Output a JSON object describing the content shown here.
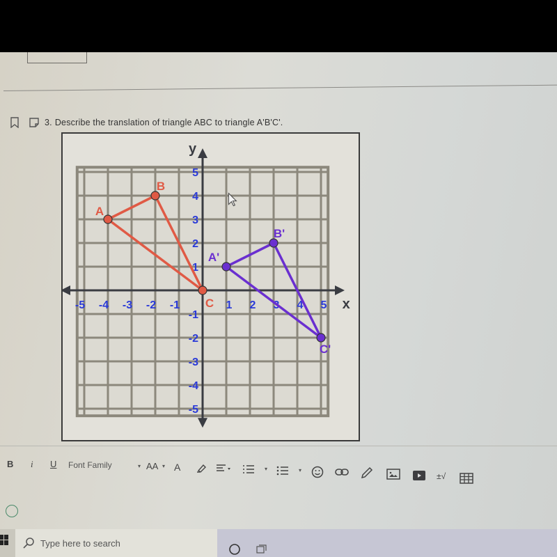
{
  "question": {
    "number": "3.",
    "text": "Describe the translation of triangle ABC to triangle A'B'C'."
  },
  "chart_data": {
    "type": "scatter",
    "title": "",
    "xlabel": "x",
    "ylabel": "y",
    "xlim": [
      -5,
      5
    ],
    "ylim": [
      -5,
      5
    ],
    "grid": true,
    "x_ticks": [
      "-5",
      "-4",
      "-3",
      "-2",
      "-1",
      "1",
      "2",
      "3",
      "4",
      "5"
    ],
    "y_ticks": [
      "5",
      "4",
      "3",
      "2",
      "1",
      "-1",
      "-2",
      "-3",
      "-4",
      "-5"
    ],
    "series": [
      {
        "name": "Triangle ABC",
        "color": "#e05a45",
        "points": [
          {
            "label": "A",
            "x": -4,
            "y": 3
          },
          {
            "label": "B",
            "x": -2,
            "y": 4
          },
          {
            "label": "C",
            "x": 0,
            "y": 0
          }
        ]
      },
      {
        "name": "Triangle A'B'C'",
        "color": "#6a2fd0",
        "points": [
          {
            "label": "A'",
            "x": 1,
            "y": 1
          },
          {
            "label": "B'",
            "x": 3,
            "y": 2
          },
          {
            "label": "C'",
            "x": 5,
            "y": -2
          }
        ]
      }
    ],
    "tick_color": "#2a3ad8",
    "axis_color": "#3a3c42"
  },
  "toolbar": {
    "bold": "B",
    "italic": "i",
    "underline": "U",
    "font_family": "Font Family",
    "font_size": "AA",
    "font_color": "A",
    "math": "±√",
    "caret": "▾"
  },
  "taskbar": {
    "search_placeholder": "Type here to search"
  }
}
